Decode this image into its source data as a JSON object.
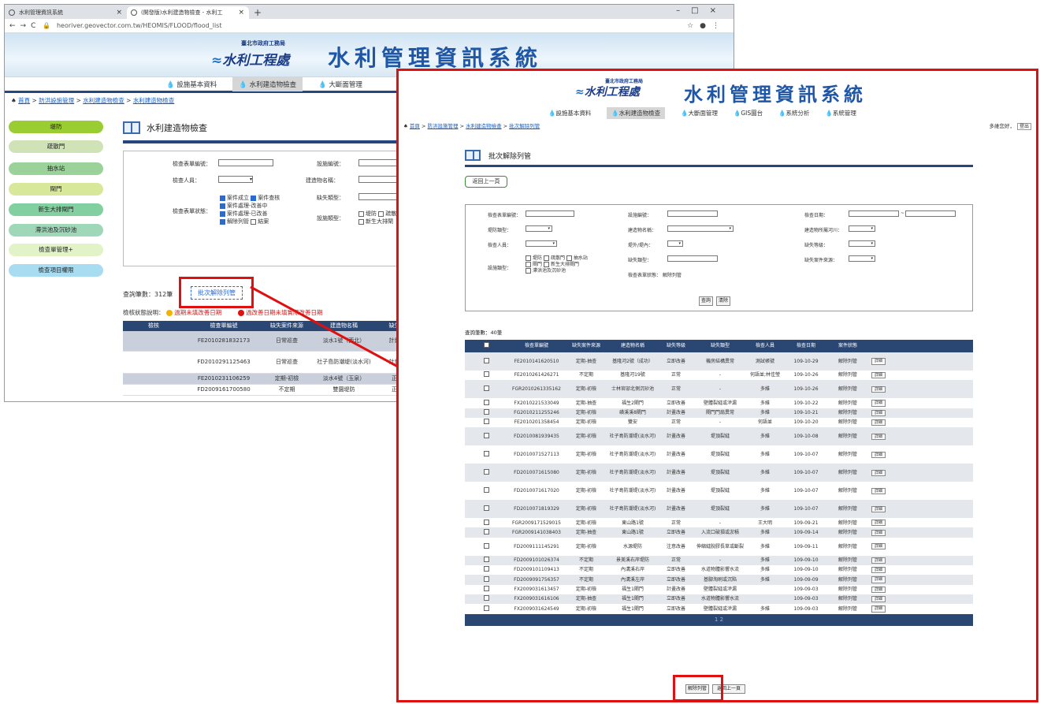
{
  "browser": {
    "tabs": [
      {
        "label": "水利管理資訊系統"
      },
      {
        "label": "(開發版)水利建造物檢查 - 水利工"
      }
    ],
    "url": "heoriver.geovector.com.tw/HEOMIS/FLOOD/flood_list"
  },
  "header": {
    "org_name": "臺北市政府工務局",
    "org_unit": "水利工程處",
    "system_title": "水利管理資訊系統"
  },
  "back": {
    "menu": [
      "設施基本資料",
      "水利建造物檢查",
      "大斷面管理"
    ],
    "breadcrumb": [
      "首頁",
      "防洪設施管理",
      "水利建造物檢查",
      "水利建造物檢查"
    ],
    "sidebar": [
      "堤防",
      "疏散門",
      "抽水站",
      "閘門",
      "新生大排閘門",
      "滯洪池及沉砂池",
      "檢查單管理+",
      "檢查項目權限"
    ],
    "page_title": "水利建造物檢查",
    "form": {
      "form_no": "檢查表單編號：",
      "inspector": "檢查人員：",
      "status": "檢查表單狀態：",
      "facility_no": "設施編號：",
      "building_name": "建造物名稱：",
      "defect_type": "缺失類型：",
      "facility_type": "設施類型：",
      "status_options": [
        "案件成立",
        "案件查核",
        "案件處理-改善中",
        "案件處理-已改善",
        "解除列管",
        "結案"
      ],
      "facility_options": [
        "堤防",
        "疏散",
        "新生大排閘"
      ]
    },
    "count": "查詢筆數：312筆",
    "batch_btn": "批次解除列管",
    "legend_label": "檢核狀態說明：",
    "legend_items": [
      "過期未填改善日期",
      "過改善日期未填實際改善日期"
    ],
    "table": {
      "headers": [
        "檢核",
        "檢查單編號",
        "缺失案件來源",
        "建造物名稱",
        "缺失等"
      ],
      "rows": [
        [
          "",
          "FE2010281832173",
          "日常巡查",
          "淡水1號（西北）",
          "計畫改"
        ],
        [
          "",
          "FD2010291125463",
          "日常巡查",
          "社子島防潮堤(淡水河)",
          "計畫改"
        ],
        [
          "",
          "FE2010231106259",
          "定期-初檢",
          "淡水4號（玉泉）",
          "正常"
        ],
        [
          "",
          "FD2009161700580",
          "不定期",
          "雙園堤防",
          "正常"
        ]
      ]
    }
  },
  "front": {
    "menu": [
      "設施基本資料",
      "水利建造物檢查",
      "大斷面管理",
      "GIS圖台",
      "系統分析",
      "系統管理"
    ],
    "breadcrumb": [
      "首頁",
      "防洪設施管理",
      "水利建造物檢查",
      "批次解除列管"
    ],
    "greeting": "多維您好，",
    "logout": "登出",
    "page_title": "批次解除列管",
    "back_btn": "返回上一頁",
    "form": {
      "form_no": "檢查表單編號：",
      "facility_no": "設施編號：",
      "check_date": "檢查日期：",
      "date_sep": "~",
      "levee_type": "堤防類型：",
      "building_name": "建造物名稱：",
      "river": "建造物所屬河川：",
      "inspector": "檢查人員：",
      "inout": "堤外/堤內：",
      "defect_level": "缺失等級：",
      "facility_type": "設施類型：",
      "facility_options": [
        "堤防",
        "疏散門",
        "抽水站",
        "閘門",
        "新生大排閘門",
        "滯洪池及沉砂池"
      ],
      "defect_type": "缺失類型：",
      "defect_source": "缺失案件來源：",
      "status_label": "檢查表單狀態：",
      "status_value": "解除列管",
      "search_btn": "查詢",
      "clear_btn": "清除"
    },
    "count": "查詢筆數：40筆",
    "table": {
      "headers": [
        "",
        "檢查單編號",
        "缺失案件來源",
        "建造物名稱",
        "缺失等級",
        "缺失類型",
        "檢查人員",
        "檢查日期",
        "案件狀態",
        ""
      ],
      "detail_label": "詳細",
      "rows": [
        [
          "FE2010141620510",
          "定期-抽查",
          "基隆河2號（成功）",
          "立即改善",
          "機房結構異常",
          "測試帳號",
          "109-10-29",
          "解除列管"
        ],
        [
          "FE2010261426271",
          "不定期",
          "基隆河19號",
          "正常",
          "-",
          "何語並;林佳瑩",
          "109-10-26",
          "解除列管"
        ],
        [
          "FGR2010261335162",
          "定期-初檢",
          "士林官邸北側沉砂池",
          "正常",
          "-",
          "多維",
          "109-10-26",
          "解除列管"
        ],
        [
          "FX2010221533049",
          "定期-抽查",
          "福生2閘門",
          "立即改善",
          "壁體裂縫或滲漏",
          "多維",
          "109-10-22",
          "解除列管"
        ],
        [
          "FG2010211255246",
          "定期-初檢",
          "磺溪溪8閘門",
          "計畫改善",
          "閘門門扇異常",
          "多維",
          "109-10-21",
          "解除列管"
        ],
        [
          "FE2010201358454",
          "定期-初檢",
          "雙安",
          "正常",
          "-",
          "何語並",
          "109-10-20",
          "解除列管"
        ],
        [
          "FD2010081939435",
          "定期-初檢",
          "社子島防潮堤(淡水河)",
          "計畫改善",
          "堤頂裂縫",
          "多維",
          "109-10-08",
          "解除列管"
        ],
        [
          "FD2010071527113",
          "定期-初檢",
          "社子島防潮堤(淡水河)",
          "計畫改善",
          "堤頂裂縫",
          "多維",
          "109-10-07",
          "解除列管"
        ],
        [
          "FD2010071615080",
          "定期-初檢",
          "社子島防潮堤(淡水河)",
          "計畫改善",
          "堤頂裂縫",
          "多維",
          "109-10-07",
          "解除列管"
        ],
        [
          "FD2010071617020",
          "定期-初檢",
          "社子島防潮堤(淡水河)",
          "計畫改善",
          "堤頂裂縫",
          "多維",
          "109-10-07",
          "解除列管"
        ],
        [
          "FD2010071819329",
          "定期-初檢",
          "社子島防潮堤(淡水河)",
          "計畫改善",
          "堤頂裂縫",
          "多維",
          "109-10-07",
          "解除列管"
        ],
        [
          "FGR2009171529015",
          "定期-初檢",
          "東山路1號",
          "正常",
          "-",
          "王大明",
          "109-09-21",
          "解除列管"
        ],
        [
          "FGR2009141038403",
          "定期-抽查",
          "東山路1號",
          "立即改善",
          "入流口破損或淤積",
          "多維",
          "109-09-14",
          "解除列管"
        ],
        [
          "FD2009111145291",
          "定期-初檢",
          "水源堤防",
          "注意改善",
          "伸縮縫脫膠長草或斷裂",
          "多維",
          "109-09-11",
          "解除列管"
        ],
        [
          "FD2009101026374",
          "不定期",
          "景美溪右岸堤防",
          "正常",
          "-",
          "多維",
          "109-09-10",
          "解除列管"
        ],
        [
          "FD2009101109413",
          "不定期",
          "內溝溪右岸",
          "立即改善",
          "水道物體影響水流",
          "多維",
          "109-09-10",
          "解除列管"
        ],
        [
          "FD2009091756357",
          "不定期",
          "內溝溪左岸",
          "立即改善",
          "基腳淘刷或沉陷",
          "多維",
          "109-09-09",
          "解除列管"
        ],
        [
          "FX2009031613457",
          "定期-初檢",
          "福生1閘門",
          "計畫改善",
          "壁體裂縫或滲漏",
          "",
          "109-09-03",
          "解除列管"
        ],
        [
          "FX2009031616106",
          "定期-抽查",
          "福生1閘門",
          "立即改善",
          "水道物體影響水流",
          "",
          "109-09-03",
          "解除列管"
        ],
        [
          "FX2009031624549",
          "定期-初檢",
          "福生1閘門",
          "立即改善",
          "壁體裂縫或滲漏",
          "多維",
          "109-09-03",
          "解除列管"
        ]
      ],
      "pager": "1 2"
    },
    "bottom_btns": [
      "解除列管",
      "返回上一頁"
    ]
  }
}
